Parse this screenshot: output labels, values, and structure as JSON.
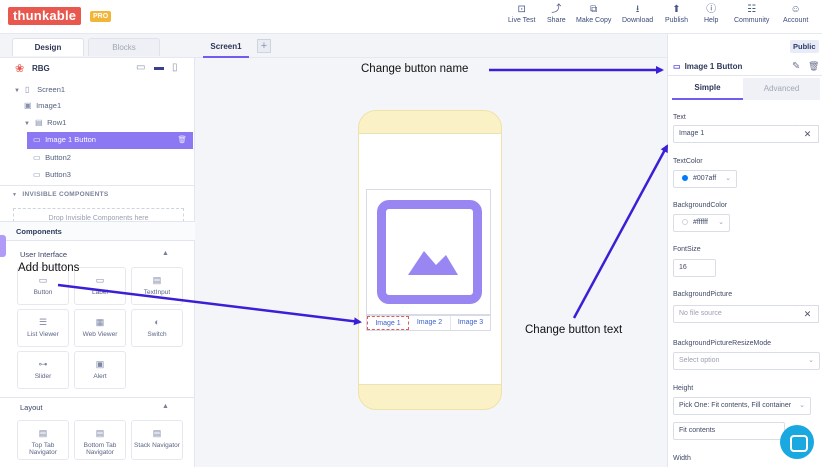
{
  "app": {
    "logo": "thunkable",
    "badge": "PRO"
  },
  "topnav": [
    {
      "icon": "test-icon",
      "glyph": "⊡",
      "label": "Live Test"
    },
    {
      "icon": "share-icon",
      "glyph": "⤴",
      "label": "Share"
    },
    {
      "icon": "copy-icon",
      "glyph": "⧉",
      "label": "Make Copy"
    },
    {
      "icon": "download-icon",
      "glyph": "⭳",
      "label": "Download"
    },
    {
      "icon": "publish-icon",
      "glyph": "⬆",
      "label": "Publish"
    },
    {
      "icon": "help-icon",
      "glyph": "ⓘ",
      "label": "Help"
    },
    {
      "icon": "community-icon",
      "glyph": "☷",
      "label": "Community"
    },
    {
      "icon": "account-icon",
      "glyph": "☺",
      "label": "Account"
    }
  ],
  "left": {
    "tab_design": "Design",
    "tab_blocks": "Blocks",
    "project": "RBG",
    "tree": [
      {
        "name": "tree-screen1",
        "icon": "▯",
        "label": "Screen1"
      },
      {
        "name": "tree-image1",
        "icon": "▣",
        "label": "Image1"
      },
      {
        "name": "tree-row1",
        "icon": "▤",
        "label": "Row1"
      },
      {
        "name": "tree-image1-button",
        "icon": "▭",
        "label": "Image 1 Button"
      },
      {
        "name": "tree-button2",
        "icon": "▭",
        "label": "Button2"
      },
      {
        "name": "tree-button3",
        "icon": "▭",
        "label": "Button3"
      }
    ],
    "invisible_title": "INVISIBLE COMPONENTS",
    "drop_hint": "Drop Invisible Components here",
    "components_title": "Components",
    "ui_title": "User Interface",
    "ui_tiles": [
      {
        "icon": "▭",
        "label": "Button"
      },
      {
        "icon": "▭",
        "label": "Label"
      },
      {
        "icon": "▤",
        "label": "TextInput"
      },
      {
        "icon": "☰",
        "label": "List Viewer"
      },
      {
        "icon": "▦",
        "label": "Web Viewer"
      },
      {
        "icon": "◐",
        "label": "Switch"
      },
      {
        "icon": "⊶",
        "label": "Slider"
      },
      {
        "icon": "▣",
        "label": "Alert"
      }
    ],
    "layout_title": "Layout",
    "layout_tiles": [
      {
        "icon": "▤",
        "label": "Top Tab Navigator"
      },
      {
        "icon": "▤",
        "label": "Bottom Tab Navigator"
      },
      {
        "icon": "▤",
        "label": "Stack Navigator"
      }
    ]
  },
  "middle": {
    "screen_tab": "Screen1",
    "add_tab": "+",
    "buttons": [
      "Image 1",
      "Image 2",
      "Image 3"
    ]
  },
  "right": {
    "public_badge": "Public",
    "component_title": "Image 1 Button",
    "tab_simple": "Simple",
    "tab_advanced": "Advanced",
    "text_label": "Text",
    "text_value": "Image 1",
    "textcolor_label": "TextColor",
    "textcolor_value": "#007aff",
    "textcolor_swatch": "#007aff",
    "bgcolor_label": "BackgroundColor",
    "bgcolor_value": "#ffffff",
    "fontsize_label": "FontSize",
    "fontsize_value": "16",
    "bgpicture_label": "BackgroundPicture",
    "bgpicture_placeholder": "No file source",
    "resize_label": "BackgroundPictureResizeMode",
    "resize_placeholder": "Select option",
    "height_label": "Height",
    "height_value": "Pick One: Fit contents, Fill container",
    "height_sub": "Fit contents",
    "width_label": "Width"
  },
  "annotations": {
    "change_name": "Change button name",
    "add_buttons": "Add buttons",
    "change_text": "Change button text"
  },
  "colors": {
    "accent": "#6d5ef0",
    "arrow": "#3a1fd6",
    "logo": "#e8584f"
  }
}
